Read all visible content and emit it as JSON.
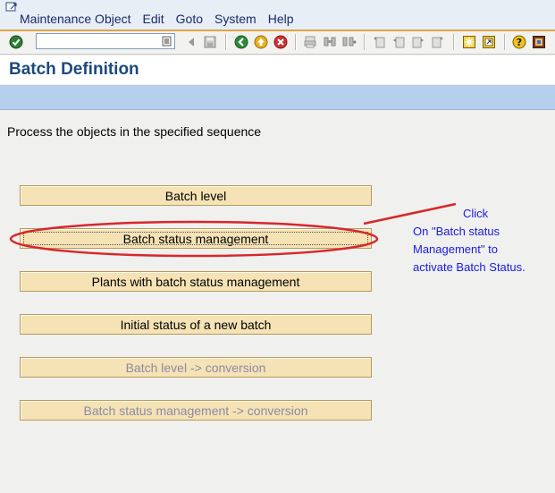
{
  "menubar": {
    "items": [
      "Maintenance Object",
      "Edit",
      "Goto",
      "System",
      "Help"
    ]
  },
  "toolbar": {
    "command_value": "",
    "icons": [
      "enter-icon",
      "save-icon",
      "back-icon",
      "exit-icon",
      "cancel-icon",
      "print-icon",
      "find-icon",
      "find-next-icon",
      "first-page-icon",
      "previous-page-icon",
      "next-page-icon",
      "last-page-icon",
      "create-session-icon",
      "shortcut-icon",
      "help-icon",
      "customize-layout-icon"
    ]
  },
  "page": {
    "title": "Batch Definition",
    "instruction": "Process the objects in the specified sequence"
  },
  "buttons": [
    {
      "label": "Batch level",
      "enabled": true
    },
    {
      "label": "Batch status management",
      "enabled": true,
      "focused": true
    },
    {
      "label": "Plants with batch status management",
      "enabled": true
    },
    {
      "label": "Initial status of a new batch",
      "enabled": true
    },
    {
      "label": "Batch level -> conversion",
      "enabled": false
    },
    {
      "label": "Batch status management -> conversion",
      "enabled": false
    }
  ],
  "annotation": {
    "lines": [
      "Click",
      "On \"Batch status",
      "Management\" to",
      "activate Batch Status."
    ],
    "color": "#1a1ae0",
    "highlight_color": "#d9262a"
  },
  "colors": {
    "menu_underline": "#e0a341",
    "title": "#1c4a7c",
    "button_bg": "#f5e2b5",
    "app_toolbar": "#b5cfec"
  }
}
